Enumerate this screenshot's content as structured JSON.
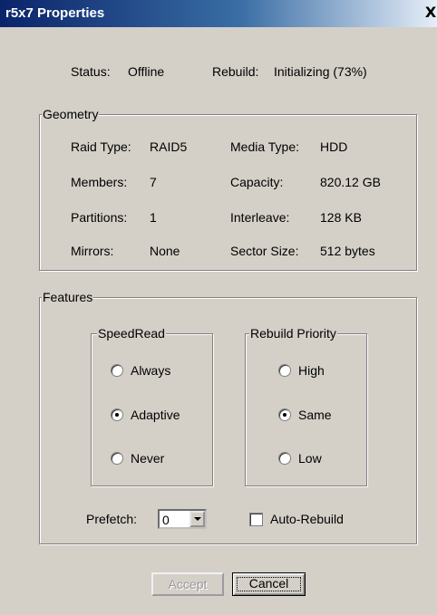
{
  "window": {
    "title": "r5x7 Properties",
    "close_glyph": "X"
  },
  "status": {
    "label": "Status:",
    "value": "Offline",
    "rebuild_label": "Rebuild:",
    "rebuild_value": "Initializing (73%)"
  },
  "geometry": {
    "legend": "Geometry",
    "raid_type_label": "Raid Type:",
    "raid_type": "RAID5",
    "media_type_label": "Media Type:",
    "media_type": "HDD",
    "members_label": "Members:",
    "members": "7",
    "capacity_label": "Capacity:",
    "capacity": "820.12 GB",
    "partitions_label": "Partitions:",
    "partitions": "1",
    "interleave_label": "Interleave:",
    "interleave": "128 KB",
    "mirrors_label": "Mirrors:",
    "mirrors": "None",
    "sector_size_label": "Sector Size:",
    "sector_size": "512 bytes"
  },
  "features": {
    "legend": "Features",
    "speedread": {
      "legend": "SpeedRead",
      "options": [
        "Always",
        "Adaptive",
        "Never"
      ],
      "selected": "Adaptive"
    },
    "rebuild_priority": {
      "legend": "Rebuild Priority",
      "options": [
        "High",
        "Same",
        "Low"
      ],
      "selected": "Same"
    },
    "prefetch_label": "Prefetch:",
    "prefetch_value": "0",
    "auto_rebuild_label": "Auto-Rebuild",
    "auto_rebuild_checked": false
  },
  "buttons": {
    "accept": "Accept",
    "cancel": "Cancel"
  }
}
